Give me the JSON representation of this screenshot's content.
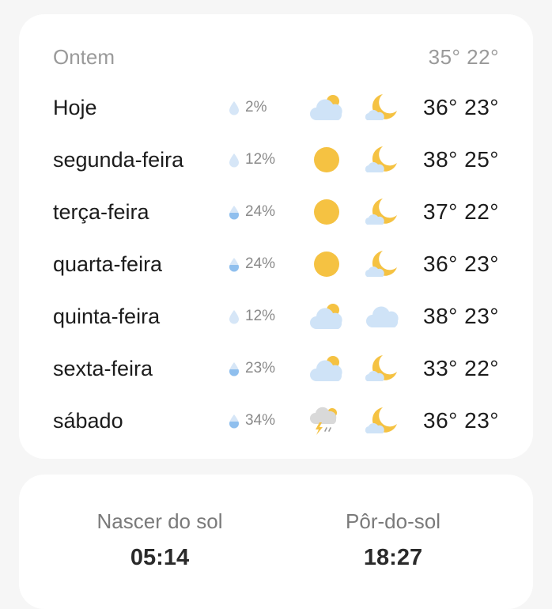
{
  "yesterday": {
    "label": "Ontem",
    "temps": "35° 22°"
  },
  "forecast": [
    {
      "day": "Hoje",
      "precip": "2%",
      "drop_level": "light",
      "day_icon": "partly-cloudy-icon",
      "night_icon": "partly-cloudy-night-icon",
      "temps": "36° 23°"
    },
    {
      "day": "segunda-feira",
      "precip": "12%",
      "drop_level": "light",
      "day_icon": "sun-icon",
      "night_icon": "partly-cloudy-night-icon",
      "temps": "38° 25°"
    },
    {
      "day": "terça-feira",
      "precip": "24%",
      "drop_level": "half",
      "day_icon": "sun-icon",
      "night_icon": "partly-cloudy-night-icon",
      "temps": "37° 22°"
    },
    {
      "day": "quarta-feira",
      "precip": "24%",
      "drop_level": "half",
      "day_icon": "sun-icon",
      "night_icon": "partly-cloudy-night-icon",
      "temps": "36° 23°"
    },
    {
      "day": "quinta-feira",
      "precip": "12%",
      "drop_level": "light",
      "day_icon": "partly-cloudy-icon",
      "night_icon": "cloud-icon",
      "temps": "38° 23°"
    },
    {
      "day": "sexta-feira",
      "precip": "23%",
      "drop_level": "half",
      "day_icon": "partly-cloudy-icon",
      "night_icon": "partly-cloudy-night-icon",
      "temps": "33° 22°"
    },
    {
      "day": "sábado",
      "precip": "34%",
      "drop_level": "half",
      "day_icon": "thunderstorm-icon",
      "night_icon": "partly-cloudy-night-icon",
      "temps": "36° 23°"
    }
  ],
  "sun": {
    "sunrise_label": "Nascer do sol",
    "sunrise_time": "05:14",
    "sunset_label": "Pôr-do-sol",
    "sunset_time": "18:27"
  },
  "colors": {
    "sun": "#f5c242",
    "cloud": "#cfe3f7",
    "moon": "#f5c242",
    "drop_light": "#d6e6f7",
    "drop_fill": "#8fbfee",
    "text_primary": "#1c1c1c",
    "text_secondary": "#9a9a9a"
  }
}
